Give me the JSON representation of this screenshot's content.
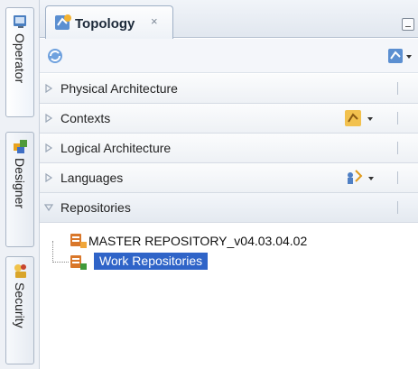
{
  "sidebar": {
    "tabs": [
      {
        "label": "Operator",
        "icon": "operator-icon"
      },
      {
        "label": "Designer",
        "icon": "designer-icon"
      },
      {
        "label": "Security",
        "icon": "security-icon"
      }
    ]
  },
  "main": {
    "tab": {
      "label": "Topology",
      "close": "×",
      "icon": "topology-icon"
    },
    "toolbar": {
      "left_icon": "refresh-icon",
      "right_icon": "connect-dropdown-icon"
    },
    "accordion": [
      {
        "label": "Physical Architecture",
        "expanded": false
      },
      {
        "label": "Contexts",
        "expanded": false,
        "icon": "new-context-icon"
      },
      {
        "label": "Logical Architecture",
        "expanded": false
      },
      {
        "label": "Languages",
        "expanded": false,
        "icon": "languages-icon"
      },
      {
        "label": "Repositories",
        "expanded": true
      }
    ],
    "tree": [
      {
        "label": "MASTER REPOSITORY_v04.03.04.02",
        "icon": "master-repository-icon",
        "selected": false
      },
      {
        "label": "Work Repositories",
        "icon": "work-repository-icon",
        "selected": true
      }
    ]
  },
  "colors": {
    "selection": "#2f64c8",
    "panel_border": "#b8c3d2"
  }
}
